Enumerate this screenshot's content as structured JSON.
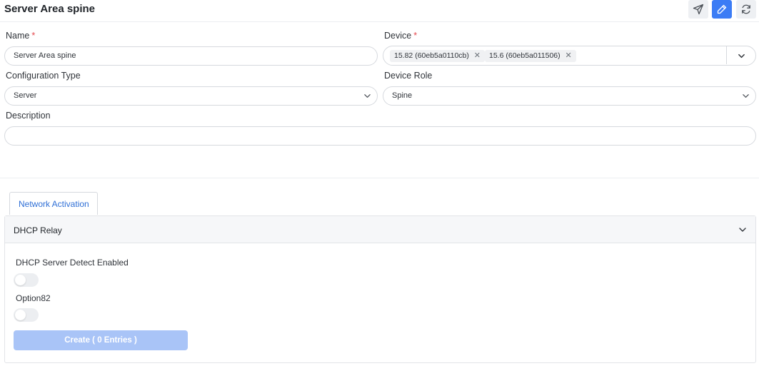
{
  "header": {
    "title": "Server Area spine",
    "buttons": [
      {
        "icon": "send-icon"
      },
      {
        "icon": "pencil-icon"
      },
      {
        "icon": "refresh-icon"
      }
    ]
  },
  "form": {
    "name": {
      "label": "Name",
      "required_mark": "*",
      "value": "Server Area spine"
    },
    "device": {
      "label": "Device",
      "required_mark": "*",
      "tags": [
        "15.82 (60eb5a0110cb)",
        "15.6 (60eb5a011506)"
      ],
      "remove_glyph": "✕"
    },
    "configuration_type": {
      "label": "Configuration Type",
      "value": "Server"
    },
    "device_role": {
      "label": "Device Role",
      "value": "Spine"
    },
    "description": {
      "label": "Description",
      "value": ""
    }
  },
  "tabs": [
    {
      "label": "Network Activation",
      "active": true
    }
  ],
  "dhcp_panel": {
    "title": "DHCP Relay",
    "expanded": true,
    "toggles": [
      {
        "label": "DHCP Server Detect Enabled",
        "on": false
      },
      {
        "label": "Option82",
        "on": false
      }
    ],
    "create_label": "Create ( 0 Entries )"
  },
  "colors": {
    "primary": "#3b7cf5",
    "primary_disabled": "#a9c4f7",
    "required": "#e5484d",
    "tab_text": "#2f6fd6"
  }
}
